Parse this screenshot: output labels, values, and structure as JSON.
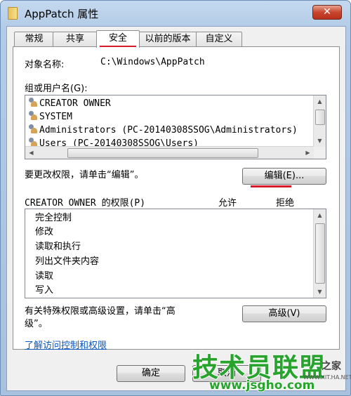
{
  "window": {
    "title": "AppPatch 属性",
    "close_glyph": "✕"
  },
  "tabs": [
    {
      "label": "常规",
      "active": false
    },
    {
      "label": "共享",
      "active": false
    },
    {
      "label": "安全",
      "active": true
    },
    {
      "label": "以前的版本",
      "active": false
    },
    {
      "label": "自定义",
      "active": false
    }
  ],
  "object": {
    "label": "对象名称:",
    "value": "C:\\Windows\\AppPatch"
  },
  "groups": {
    "label": "组或用户名(G):",
    "items": [
      "CREATOR OWNER",
      "SYSTEM",
      "Administrators (PC-20140308SSOG\\Administrators)",
      "Users (PC-20140308SSOG\\Users)"
    ]
  },
  "edit": {
    "hint": "要更改权限，请单击“编辑”。",
    "button_label": "编辑(E)..."
  },
  "permissions": {
    "header_label": "CREATOR OWNER 的权限(P)",
    "allow_label": "允许",
    "deny_label": "拒绝",
    "items": [
      "完全控制",
      "修改",
      "读取和执行",
      "列出文件夹内容",
      "读取",
      "写入"
    ]
  },
  "advanced": {
    "hint_line1": "有关特殊权限或高级设置，请单击“高",
    "hint_line2": "级”。",
    "button_label": "高级(V)"
  },
  "learn_link": "了解访问控制和权限",
  "footer": {
    "ok_label": "确定",
    "cancel_label": "取消"
  },
  "watermark": {
    "main": "技术员联盟",
    "url": "www.jsgho.com",
    "side": "之家",
    "small": "WWW.XIT.HA.NET"
  },
  "colors": {
    "accent_red": "#d7192a",
    "link_blue": "#0a57c2",
    "watermark_green": "#28a32e"
  },
  "icons": {
    "close": "close-icon",
    "user": "user-group-icon",
    "folder": "folder-icon"
  }
}
